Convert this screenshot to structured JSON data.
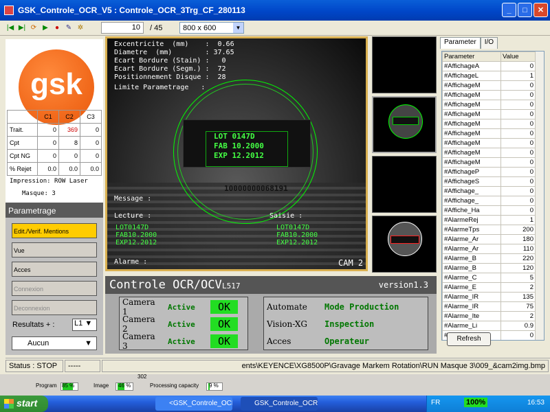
{
  "window": {
    "title": "GSK_Controle_OCR_V5 : Controle_OCR_3Trg_CF_280113"
  },
  "toolbar": {
    "page_current": "10",
    "page_total": "/ 45",
    "resolution": "800 x 600"
  },
  "logo": {
    "text": "gsk"
  },
  "stats": {
    "headers": [
      "",
      "C1",
      "C2",
      "C3"
    ],
    "rows": [
      {
        "label": "Trait.",
        "c1": "0",
        "c2": "369",
        "c3": "0"
      },
      {
        "label": "Cpt",
        "c1": "0",
        "c2": "8",
        "c3": "0"
      },
      {
        "label": "Cpt NG",
        "c1": "0",
        "c2": "0",
        "c3": "0"
      },
      {
        "label": "% Rejet",
        "c1": "0.0",
        "c2": "0.0",
        "c3": "0.0"
      }
    ]
  },
  "impression": "Impression: ROW Laser",
  "masque": "Masque: 3",
  "parametrage": {
    "title": "Parametrage",
    "edit": "Edit./Verif. Mentions",
    "vue": "Vue",
    "acces": "Acces",
    "connexion": "Connexion",
    "deconnexion": "Deconnexion",
    "resultats": "Resultats + :",
    "resultats_sel": "L1",
    "aucun": "Aucun"
  },
  "camera_view": {
    "lines": [
      "Excentricite  (mm)    :  0.66",
      "Diametre  (mm)        : 37.65",
      "Ecart Bordure (Stain) :   0",
      "Ecart Bordure (Segm.) :  72",
      "Positionnement Disque :  28"
    ],
    "limite": "Limite Parametrage   :",
    "ocr_center": [
      "LOT 0147D",
      "FAB 10.2000",
      "EXP 12.2012"
    ],
    "serial": "10000000068191",
    "message": "Message :",
    "lecture_label": "Lecture :",
    "saisie_label": "Saisie :",
    "lecture": [
      "LOT0147D",
      "FAB10.2000",
      "EXP12.2012"
    ],
    "saisie": [
      "LOT0147D",
      "FAB10.2000",
      "EXP12.2012"
    ],
    "alarme": "Alarme :",
    "cam": "CAM 2"
  },
  "control": {
    "title": "Controle OCR/OCV",
    "code": "L517",
    "version": "version1.3",
    "cameras": [
      {
        "name": "Camera 1",
        "state": "Active",
        "status": "OK"
      },
      {
        "name": "Camera 2",
        "state": "Active",
        "status": "OK"
      },
      {
        "name": "Camera 3",
        "state": "Active",
        "status": "OK"
      }
    ],
    "systems": [
      {
        "name": "Automate",
        "value": "Mode Production"
      },
      {
        "name": "Vision-XG",
        "value": "Inspection"
      },
      {
        "name": "Acces",
        "value": "Operateur"
      }
    ]
  },
  "right_panel": {
    "tabs": [
      "Parameter",
      "I/O"
    ],
    "headers": [
      "Parameter",
      "Value"
    ],
    "rows": [
      [
        "#AffichageA",
        "0"
      ],
      [
        "#AffichageL",
        "1"
      ],
      [
        "#AffichageM",
        "0"
      ],
      [
        "#AffichageM",
        "0"
      ],
      [
        "#AffichageM",
        "0"
      ],
      [
        "#AffichageM",
        "0"
      ],
      [
        "#AffichageM",
        "0"
      ],
      [
        "#AffichageM",
        "0"
      ],
      [
        "#AffichageM",
        "0"
      ],
      [
        "#AffichageM",
        "0"
      ],
      [
        "#AffichageM",
        "0"
      ],
      [
        "#AffichageP",
        "0"
      ],
      [
        "#AffichageS",
        "0"
      ],
      [
        "#Affichage_",
        "0"
      ],
      [
        "#Affichage_",
        "0"
      ],
      [
        "#Affiche_Ha",
        "0"
      ],
      [
        "#AlarmeRej",
        "1"
      ],
      [
        "#AlarmeTps",
        "200"
      ],
      [
        "#Alarme_Ar",
        "180"
      ],
      [
        "#Alarme_Ar",
        "110"
      ],
      [
        "#Alarme_B",
        "220"
      ],
      [
        "#Alarme_B",
        "120"
      ],
      [
        "#Alarme_C",
        "5"
      ],
      [
        "#Alarme_E",
        "2"
      ],
      [
        "#Alarme_IR",
        "135"
      ],
      [
        "#Alarme_IR",
        "75"
      ],
      [
        "#Alarme_Ite",
        "2"
      ],
      [
        "#Alarme_Li",
        "0.9"
      ],
      [
        "#CM",
        "0"
      ]
    ],
    "refresh": "Refresh"
  },
  "statusbar": {
    "status": "Status : STOP",
    "dashes": "-----",
    "path": "ents\\KEYENCE\\XG8500P\\Gravage Markem Rotation\\RUN Masque 3\\009_&cam2img.bmp"
  },
  "behind": {
    "program_label": "Program",
    "program_pct": "85 %",
    "image_label": "Image",
    "image_pct": "46 %",
    "processing_label": "Processing capacity",
    "processing_pct": "9 %",
    "code": "302"
  },
  "taskbar": {
    "start": "start",
    "task1": "<GSK_Controle_OCR....",
    "task2": "GSK_Controle_OCR_...",
    "lang": "FR",
    "zoom": "100%",
    "time": "16:53"
  },
  "colors": {
    "accent_orange": "#f26b1d",
    "ok_green": "#22dd22",
    "status_green": "#007700",
    "frame_gold": "#d9b050"
  }
}
